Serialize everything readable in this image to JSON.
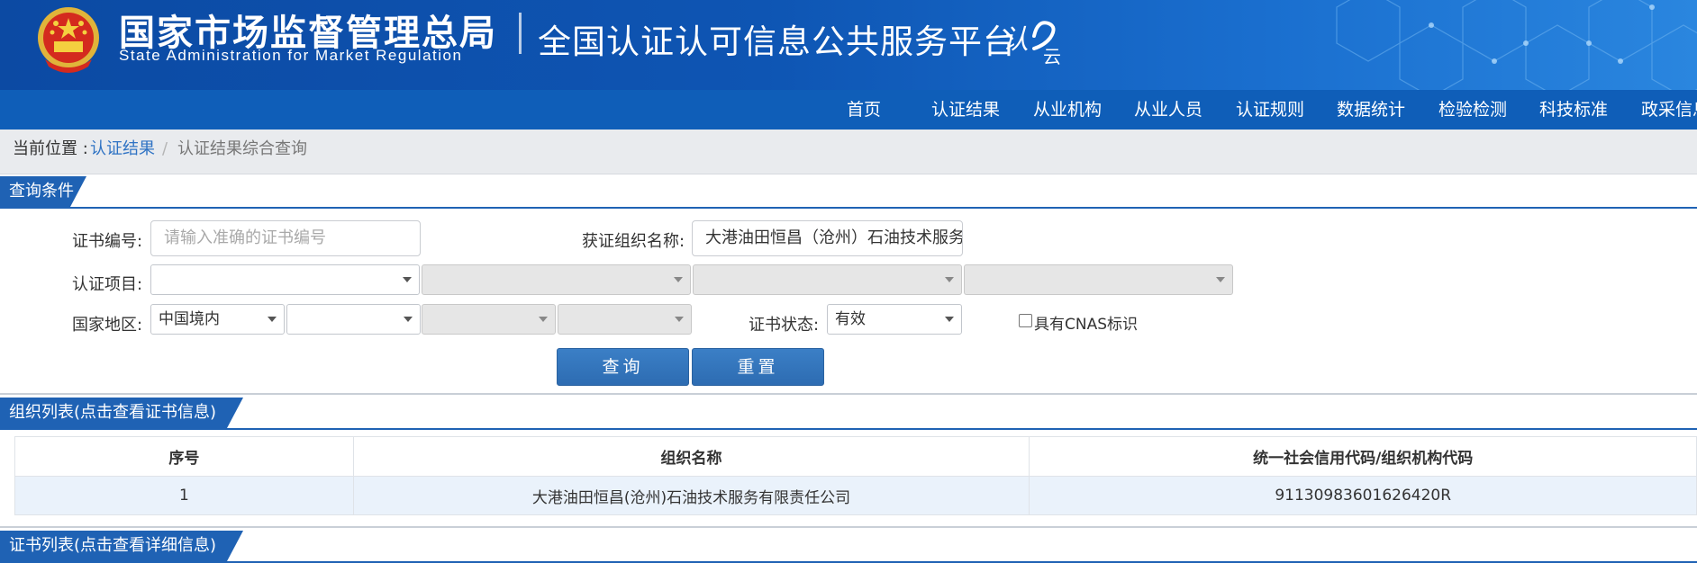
{
  "header": {
    "agency_cn": "国家市场监督管理总局",
    "agency_en": "State Administration  for  Market Regulation",
    "platform_title": "全国认证认可信息公共服务平台",
    "logo_icon": "national-emblem-icon",
    "platform_logo_icon": "renzheng-cloud-logo-icon",
    "colors": {
      "header_blue": "#0c4aa3",
      "nav_blue": "#0f5eb8",
      "accent": "#1f62b4",
      "link": "#2f73c4"
    }
  },
  "nav": {
    "items": [
      {
        "label": "首页"
      },
      {
        "label": "认证结果"
      },
      {
        "label": "从业机构"
      },
      {
        "label": "从业人员"
      },
      {
        "label": "认证规则"
      },
      {
        "label": "数据统计"
      },
      {
        "label": "检验检测"
      },
      {
        "label": "科技标准"
      },
      {
        "label": "政采信息"
      }
    ]
  },
  "breadcrumb": {
    "prefix": "当前位置 :",
    "link": "认证结果",
    "separator": "/",
    "current": "认证结果综合查询"
  },
  "query": {
    "section_title": "查询条件",
    "cert_no_label": "证书编号:",
    "cert_no_placeholder": "请输入准确的证书编号",
    "org_name_label": "获证组织名称:",
    "org_name_value": "大港油田恒昌（沧州）石油技术服务",
    "cert_item_label": "认证项目:",
    "region_label": "国家地区:",
    "region_value": "中国境内",
    "status_label": "证书状态:",
    "status_value": "有效",
    "cnas_label": "具有CNAS标识",
    "cnas_checked": false,
    "search_button": "查询",
    "reset_button": "重置"
  },
  "org_list": {
    "section_title": "组织列表(点击查看证书信息)",
    "columns": [
      "序号",
      "组织名称",
      "统一社会信用代码/组织机构代码"
    ],
    "rows": [
      {
        "index": "1",
        "name": "大港油田恒昌(沧州)石油技术服务有限责任公司",
        "code": "91130983601626420R"
      }
    ]
  },
  "cert_list": {
    "section_title": "证书列表(点击查看详细信息)"
  }
}
